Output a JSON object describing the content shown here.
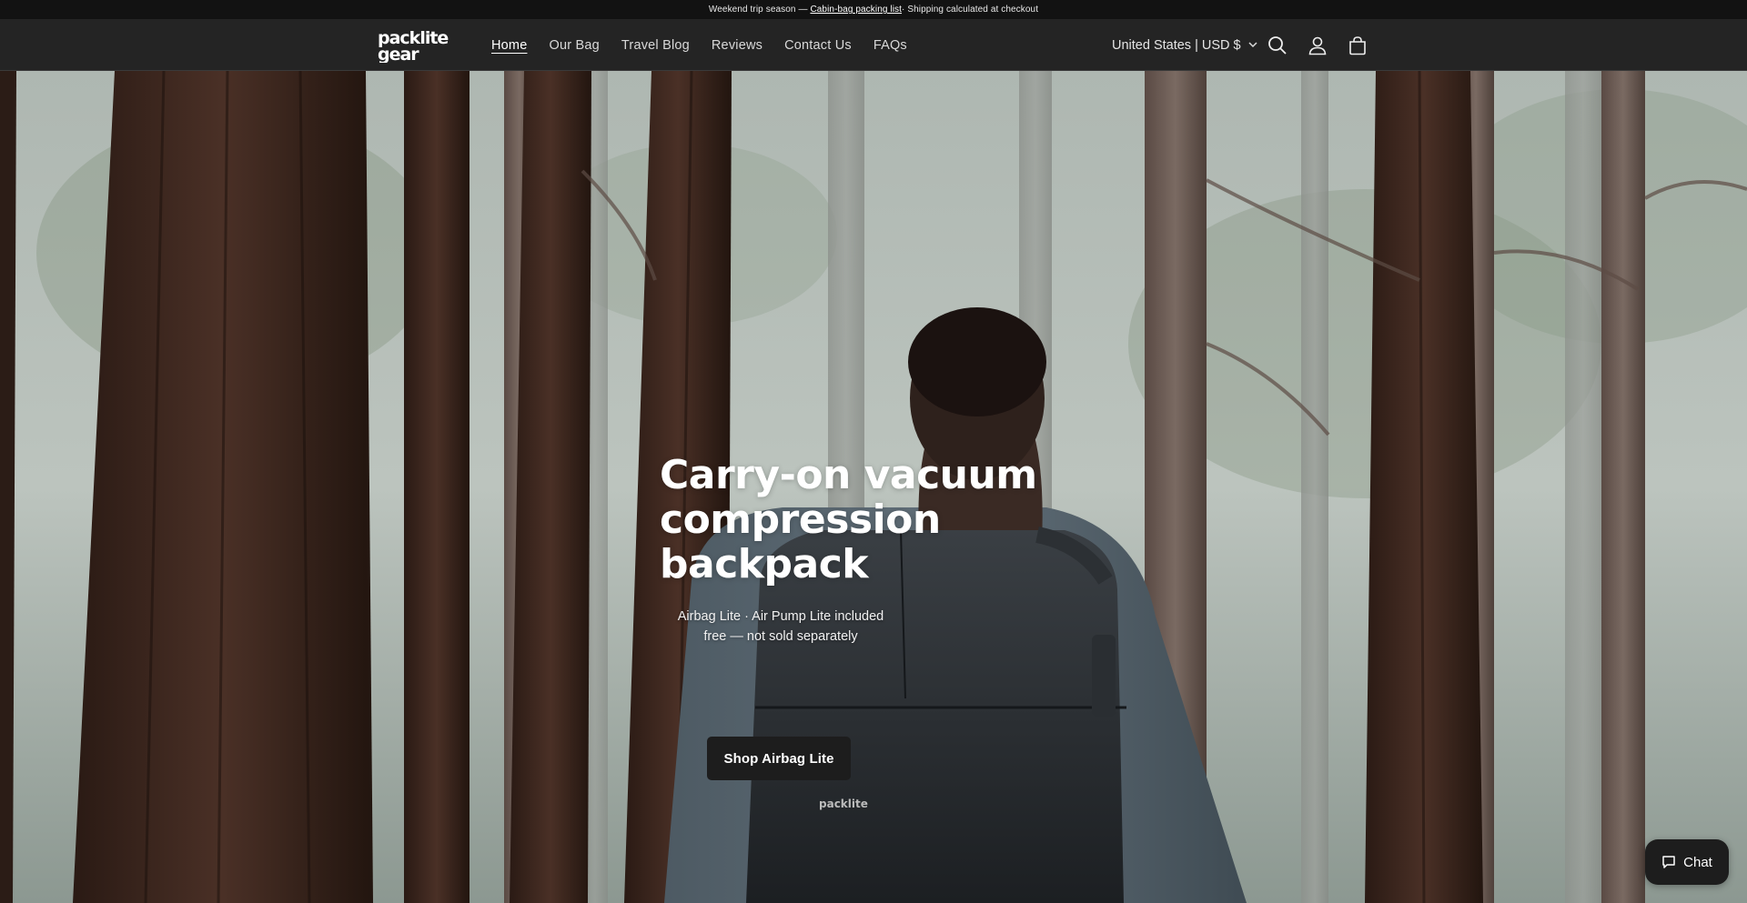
{
  "announcement": {
    "prefix": "Weekend trip season — ",
    "link": "Cabin-bag packing list",
    "suffix": " · Shipping calculated at checkout"
  },
  "header": {
    "logo_text": "packlite gear",
    "nav": [
      {
        "label": "Home",
        "active": true
      },
      {
        "label": "Our Bag",
        "active": false
      },
      {
        "label": "Travel Blog",
        "active": false
      },
      {
        "label": "Reviews",
        "active": false
      },
      {
        "label": "Contact Us",
        "active": false
      },
      {
        "label": "FAQs",
        "active": false
      }
    ],
    "locale": "United States | USD $",
    "icons": [
      "search-icon",
      "account-icon",
      "cart-icon"
    ]
  },
  "hero": {
    "title": "Carry-on vacuum compression backpack",
    "subtitle": "Airbag Lite · Air Pump Lite included free — not sold separately",
    "cta": "Shop Airbag Lite"
  },
  "chat": {
    "label": "Chat"
  }
}
